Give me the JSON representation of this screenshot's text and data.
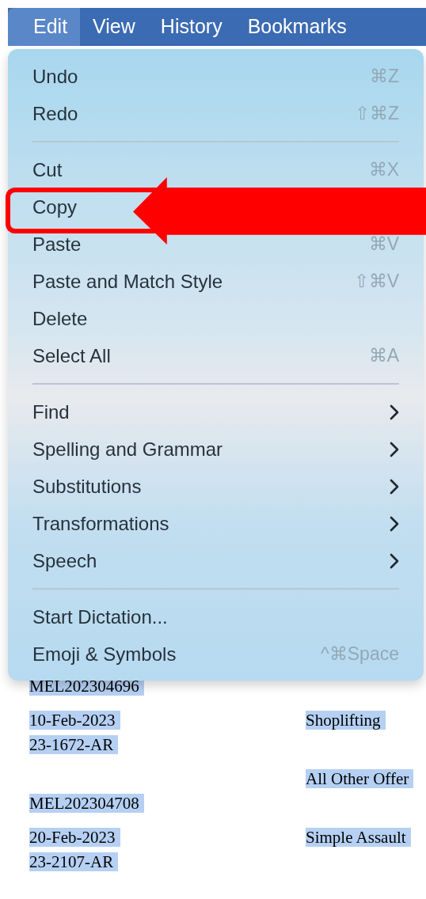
{
  "menu_bar": [
    {
      "label": "Edit",
      "selected": true
    },
    {
      "label": "View",
      "selected": false
    },
    {
      "label": "History",
      "selected": false
    },
    {
      "label": "Bookmarks",
      "selected": false
    }
  ],
  "menu": [
    {
      "kind": "item",
      "label": "Undo",
      "shortcut": "⌘Z",
      "annotated": false
    },
    {
      "kind": "item",
      "label": "Redo",
      "shortcut": "⇧⌘Z",
      "annotated": false
    },
    {
      "kind": "separator"
    },
    {
      "kind": "item",
      "label": "Cut",
      "shortcut": "⌘X",
      "annotated": false
    },
    {
      "kind": "item",
      "label": "Copy",
      "annotated": true
    },
    {
      "kind": "item",
      "label": "Paste",
      "shortcut": "⌘V",
      "annotated": false
    },
    {
      "kind": "item",
      "label": "Paste and Match Style",
      "shortcut": "⇧⌘V",
      "annotated": false
    },
    {
      "kind": "item",
      "label": "Delete",
      "annotated": false
    },
    {
      "kind": "item",
      "label": "Select All",
      "shortcut": "⌘A",
      "annotated": false
    },
    {
      "kind": "separator"
    },
    {
      "kind": "submenu",
      "label": "Find",
      "annotated": false
    },
    {
      "kind": "submenu",
      "label": "Spelling and Grammar",
      "annotated": false
    },
    {
      "kind": "submenu",
      "label": "Substitutions",
      "annotated": false
    },
    {
      "kind": "submenu",
      "label": "Transformations",
      "annotated": false
    },
    {
      "kind": "submenu",
      "label": "Speech",
      "annotated": false
    },
    {
      "kind": "separator"
    },
    {
      "kind": "item",
      "label": "Start Dictation...",
      "annotated": false
    },
    {
      "kind": "item",
      "label": "Emoji & Symbols",
      "shortcut": "^⌘Space",
      "annotated": false
    }
  ],
  "document": [
    {
      "lines": [
        {
          "left": "MEL202304696",
          "selected": true
        }
      ]
    },
    {
      "lines": [
        {
          "left": "10-Feb-2023",
          "right": "Shoplifting",
          "selected": true
        },
        {
          "left": "23-1672-AR",
          "selected": true
        }
      ]
    },
    {
      "lines": [
        {
          "right": "All Other Offer",
          "selected": true
        },
        {
          "left": "MEL202304708",
          "selected": true
        }
      ]
    },
    {
      "lines": [
        {
          "left": "20-Feb-2023",
          "right": "Simple Assault",
          "selected": true
        },
        {
          "left": "23-2107-AR",
          "selected": true
        }
      ]
    }
  ]
}
